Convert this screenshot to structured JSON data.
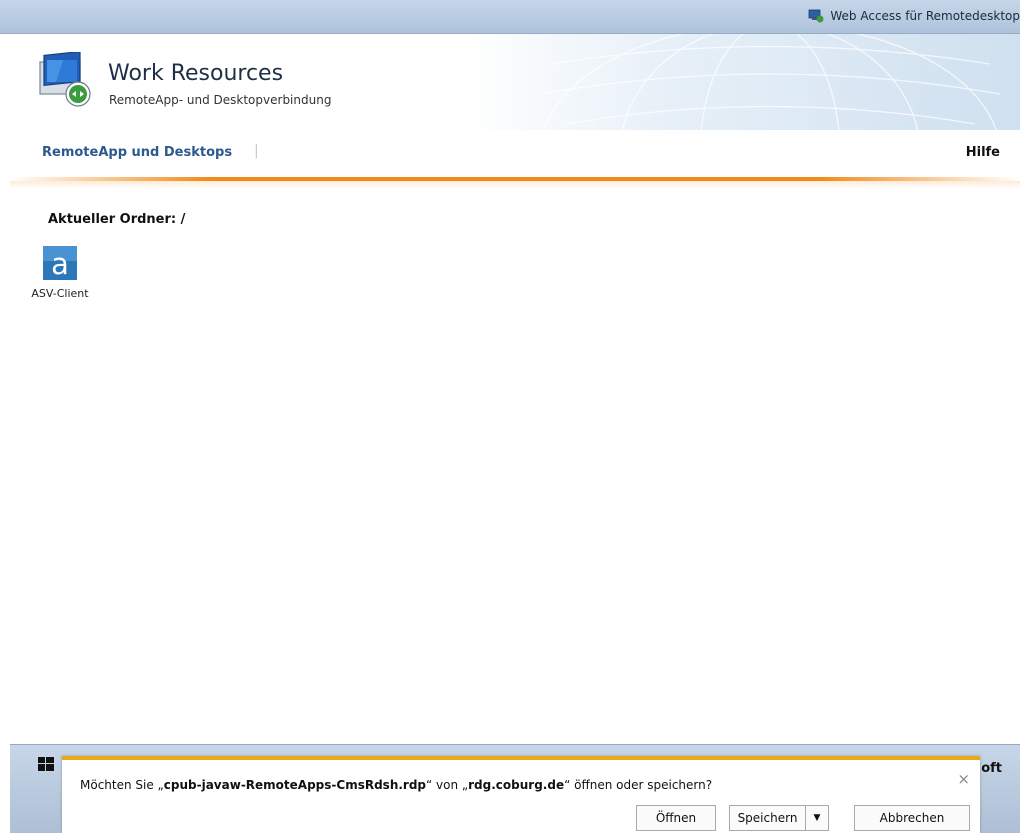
{
  "topbar": {
    "title": "Web Access für Remotedesktop",
    "icon": "remote-desktop-icon"
  },
  "header": {
    "title": "Work Resources",
    "subtitle": "RemoteApp- und Desktopverbindung"
  },
  "nav": {
    "primary": "RemoteApp und Desktops",
    "separator": "|",
    "help": "Hilfe"
  },
  "content": {
    "folder_label": "Aktueller Ordner: /",
    "apps": [
      {
        "label": "ASV-Client",
        "icon": "asv-client-icon",
        "color": "#2c77b8"
      }
    ]
  },
  "footer": {
    "text": "oft"
  },
  "notification": {
    "msg_prefix": "Möchten Sie „",
    "filename": "cpub-javaw-RemoteApps-CmsRdsh.rdp",
    "msg_mid": "“ von „",
    "host": "rdg.coburg.de",
    "msg_suffix": "“ öffnen oder speichern?",
    "open_label": "Öffnen",
    "save_label": "Speichern",
    "dropdown_glyph": "▼",
    "cancel_label": "Abbrechen",
    "close_glyph": "×",
    "accent": "#e6ab16"
  }
}
